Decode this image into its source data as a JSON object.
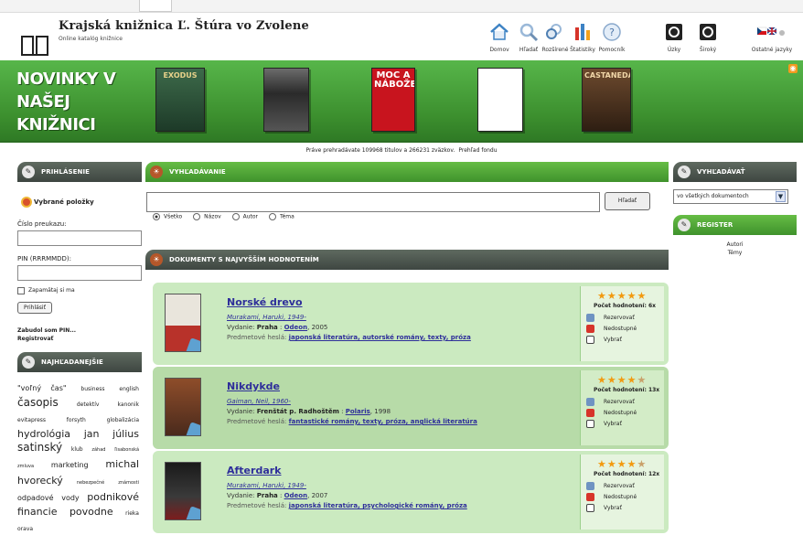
{
  "header": {
    "title": "Krajská knižnica Ľ. Štúra vo Zvolene",
    "subtitle": "Online katalóg knižnice",
    "tools": [
      {
        "label": "Domov",
        "icon": "home-icon"
      },
      {
        "label": "Hľadať",
        "icon": "search-icon"
      },
      {
        "label": "Rozšírené",
        "icon": "advanced-search-icon"
      },
      {
        "label": "Štatistiky",
        "icon": "statistics-icon"
      },
      {
        "label": "Pomocník",
        "icon": "help-icon"
      },
      {
        "label": "Úzky",
        "icon": "narrow-view-icon"
      },
      {
        "label": "Široký",
        "icon": "wide-view-icon"
      },
      {
        "label": "Ostatné jazyky",
        "icon": "language-flags-icon"
      }
    ]
  },
  "banner": {
    "heading": "NOVINKY V NAŠEJ KNIŽNICI",
    "books": [
      "EXODUS",
      "",
      "MOC A NÁBOŽENSTVO",
      "",
      "CASTANEDA"
    ]
  },
  "notice": {
    "text": "Práve prehradávate 109968 titulov a 266231 zväzkov.",
    "link": "Prehľad fondu"
  },
  "left": {
    "login_title": "Prihlásenie",
    "favorites": "Vybrané položky",
    "card_label": "Číslo preukazu:",
    "pin_label": "PIN (RRRMMDD):",
    "remember": "Zapamätaj si ma",
    "login_button": "Prihlásiť",
    "forgot": "Zabudol som PIN...",
    "register": "Registrovať",
    "popular_title": "Najhľadanejšie",
    "cloud": [
      {
        "t": "\"voľný čas\"",
        "s": 8
      },
      {
        "t": "business",
        "s": 6
      },
      {
        "t": "english",
        "s": 6
      },
      {
        "t": "časopis",
        "s": 12
      },
      {
        "t": "detektív",
        "s": 6
      },
      {
        "t": "kanonik",
        "s": 6
      },
      {
        "t": "evitapress",
        "s": 6
      },
      {
        "t": "forsyth",
        "s": 6
      },
      {
        "t": "globalizácia",
        "s": 6
      },
      {
        "t": "hydrológia",
        "s": 11
      },
      {
        "t": "jan",
        "s": 11
      },
      {
        "t": "július",
        "s": 11
      },
      {
        "t": "satinský",
        "s": 12
      },
      {
        "t": "klub",
        "s": 6
      },
      {
        "t": "záhad",
        "s": 5
      },
      {
        "t": "ľisabonská",
        "s": 5
      },
      {
        "t": "zmluva",
        "s": 5
      },
      {
        "t": "marketing",
        "s": 8
      },
      {
        "t": "michal",
        "s": 11
      },
      {
        "t": "hvorecký",
        "s": 11
      },
      {
        "t": "nebezpečné",
        "s": 5
      },
      {
        "t": "známosti",
        "s": 5
      },
      {
        "t": "odpadové",
        "s": 8
      },
      {
        "t": "vody",
        "s": 8
      },
      {
        "t": "podnikové",
        "s": 11
      },
      {
        "t": "financie",
        "s": 11
      },
      {
        "t": "povodne",
        "s": 11
      },
      {
        "t": "rieka",
        "s": 6
      },
      {
        "t": "orava",
        "s": 6
      }
    ]
  },
  "search": {
    "title": "Vyhľadávanie",
    "button": "Hľadať",
    "options": [
      "Všetko",
      "Názov",
      "Autor",
      "Téma"
    ]
  },
  "top_rated": {
    "title": "Dokumenty s najvyšším hodnotením",
    "subj_label": "Predmetové heslá:",
    "pub_label": "Vydanie:",
    "actions": [
      "Rezervovať",
      "Nedostupné",
      "Vybrať"
    ],
    "items": [
      {
        "title": "Norské drevo",
        "author": "Murakami, Haruki, 1949-",
        "place": "Praha",
        "publisher": "Odeon",
        "year": "2005",
        "subjects": "japonská literatúra, autorské romány, texty, próza",
        "rating": "Počet hodnotení: 6x",
        "stars": 5
      },
      {
        "title": "Nikdykde",
        "author": "Gaiman, Neil, 1960-",
        "place": "Frenštát p. Radhoštěm",
        "publisher": "Polaris",
        "year": "1998",
        "subjects": "fantastické romány, texty, próza, anglická literatúra",
        "rating": "Počet hodnotení: 13x",
        "stars": 4.5
      },
      {
        "title": "Afterdark",
        "author": "Murakami, Haruki, 1949-",
        "place": "Praha",
        "publisher": "Odeon",
        "year": "2007",
        "subjects": "japonská literatúra, psychologické romány, próza",
        "rating": "Počet hodnotení: 12x",
        "stars": 4.5
      }
    ]
  },
  "right": {
    "search_title": "Vyhľadávať",
    "select_value": "vo všetkých dokumentoch",
    "register_title": "Register",
    "links": [
      "Autori",
      "Témy"
    ]
  }
}
